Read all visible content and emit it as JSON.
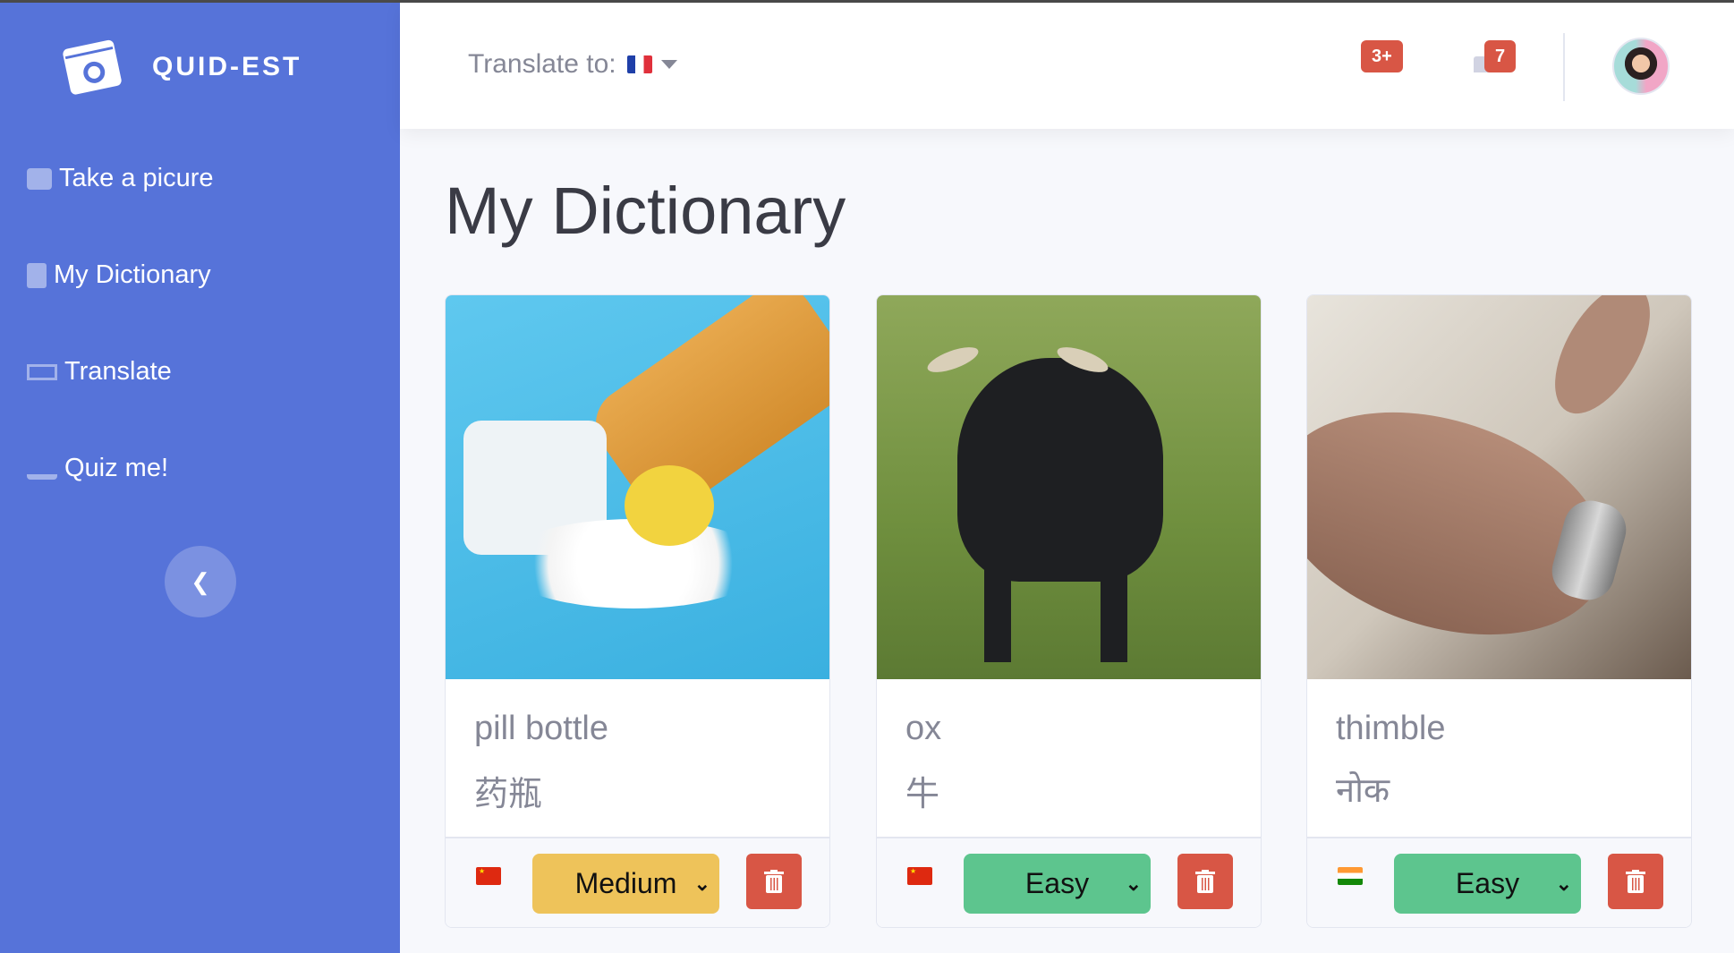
{
  "app": {
    "name": "QUID-EST"
  },
  "sidebar": {
    "items": [
      {
        "label": "Take a picure",
        "icon": "camera-icon"
      },
      {
        "label": "My Dictionary",
        "icon": "book-icon"
      },
      {
        "label": "Translate",
        "icon": "language-icon"
      },
      {
        "label": "Quiz me!",
        "icon": "user-chalkboard-icon"
      }
    ],
    "collapse_icon": "chevron-left-icon"
  },
  "header": {
    "translate_label": "Translate to:",
    "target_flag": "France",
    "alerts_badge": "3+",
    "messages_badge": "7"
  },
  "page": {
    "title": "My Dictionary"
  },
  "cards": [
    {
      "word": "pill bottle",
      "translation": "药瓶",
      "language_flag": "China",
      "difficulty": "Medium",
      "image": "pill bottle photo"
    },
    {
      "word": "ox",
      "translation": "牛",
      "language_flag": "China",
      "difficulty": "Easy",
      "image": "black ox photo"
    },
    {
      "word": "thimble",
      "translation": "नोक",
      "language_flag": "India",
      "difficulty": "Easy",
      "image": "thimble photo"
    }
  ],
  "colors": {
    "sidebar": "#5673d9",
    "medium": "#eec35a",
    "easy": "#5dc58e",
    "danger": "#d85645"
  }
}
